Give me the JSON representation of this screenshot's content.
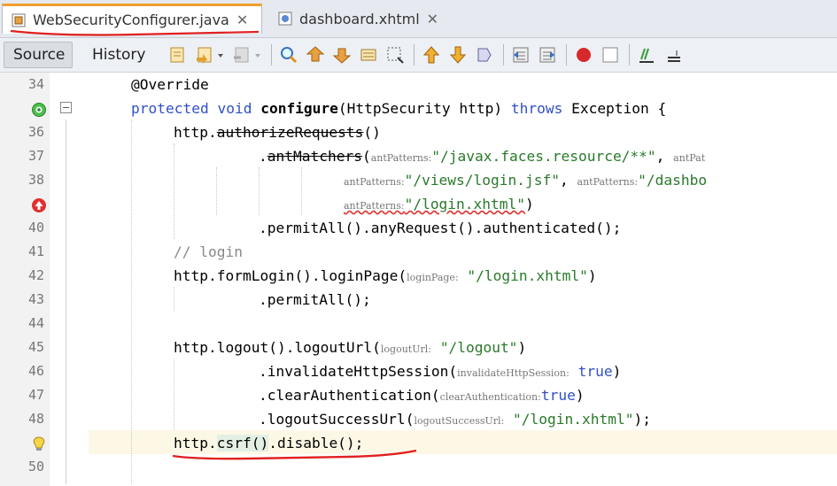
{
  "tabs": [
    {
      "label": "WebSecurityConfigurer.java",
      "active": true,
      "icon": "java-file-icon"
    },
    {
      "label": "dashboard.xhtml",
      "active": false,
      "icon": "xhtml-file-icon"
    }
  ],
  "toolbar": {
    "source_label": "Source",
    "history_label": "History",
    "icons": [
      "last-edit-icon",
      "back-icon",
      "forward-icon",
      "find-icon",
      "find-previous-icon",
      "find-next-icon",
      "toggle-highlight-icon",
      "toggle-rect-select-icon",
      "previous-bookmark-icon",
      "next-bookmark-icon",
      "toggle-bookmark-icon",
      "shift-left-icon",
      "shift-right-icon",
      "record-macro-icon",
      "stop-macro-icon",
      "comment-icon",
      "uncomment-icon"
    ]
  },
  "colors": {
    "keyword": "#3050c8",
    "string": "#2a7a2a",
    "comment": "#888888",
    "annotation_red": "#e02020"
  },
  "lines": [
    {
      "num": "34",
      "gutter": ""
    },
    {
      "num": "",
      "gutter": "override-icon"
    },
    {
      "num": "36",
      "gutter": ""
    },
    {
      "num": "37",
      "gutter": ""
    },
    {
      "num": "38",
      "gutter": ""
    },
    {
      "num": "",
      "gutter": "error-icon"
    },
    {
      "num": "40",
      "gutter": ""
    },
    {
      "num": "41",
      "gutter": ""
    },
    {
      "num": "42",
      "gutter": ""
    },
    {
      "num": "43",
      "gutter": ""
    },
    {
      "num": "44",
      "gutter": ""
    },
    {
      "num": "45",
      "gutter": ""
    },
    {
      "num": "46",
      "gutter": ""
    },
    {
      "num": "47",
      "gutter": ""
    },
    {
      "num": "48",
      "gutter": ""
    },
    {
      "num": "",
      "gutter": "bulb-icon"
    },
    {
      "num": "50",
      "gutter": ""
    }
  ],
  "code": {
    "l34": {
      "annotation": "@Override"
    },
    "l35": {
      "kw1": "protected",
      "kw2": "void",
      "method": "configure",
      "params": "(HttpSecurity http)",
      "throws": "throws",
      "rest": "Exception {"
    },
    "l36": {
      "obj": "http.",
      "method": "authorizeRequests",
      "rest": "()"
    },
    "l37": {
      "dot": ".",
      "method": "antMatchers",
      "open": "(",
      "hint1": "antPatterns:",
      "str1": "\"/javax.faces.resource/**\"",
      "sep": ", ",
      "hint2": "antPat"
    },
    "l38": {
      "hint1": "antPatterns:",
      "str1": "\"/views/login.jsf\"",
      "sep": ", ",
      "hint2": "antPatterns:",
      "str2": "\"/dashbo"
    },
    "l39": {
      "hint1": "antPatterns:",
      "str1": "\"/login.xhtml\"",
      "close": ")"
    },
    "l40": {
      "text": ".permitAll().anyRequest().authenticated();"
    },
    "l41": {
      "comment": "// login"
    },
    "l42": {
      "pre": "http.formLogin().loginPage",
      "open": "(",
      "hint": "loginPage:",
      "str": "\"/login.xhtml\"",
      "close": ")"
    },
    "l43": {
      "text": ".permitAll();"
    },
    "l45": {
      "pre": "http.logout().logoutUrl",
      "open": "(",
      "hint": "logoutUrl:",
      "str": "\"/logout\"",
      "close": ")"
    },
    "l46": {
      "pre": ".invalidateHttpSession",
      "open": "(",
      "hint": "invalidateHttpSession:",
      "kw": "true",
      "close": ")"
    },
    "l47": {
      "pre": ".clearAuthentication",
      "open": "(",
      "hint": "clearAuthentication:",
      "kw": "true",
      "close": ")"
    },
    "l48": {
      "pre": ".logoutSuccessUrl",
      "open": "(",
      "hint": "logoutSuccessUrl:",
      "str": "\"/login.xhtml\"",
      "close": ");"
    },
    "l49": {
      "pre": "http.",
      "csrf": "csrf()",
      "post": ".disable();"
    }
  }
}
